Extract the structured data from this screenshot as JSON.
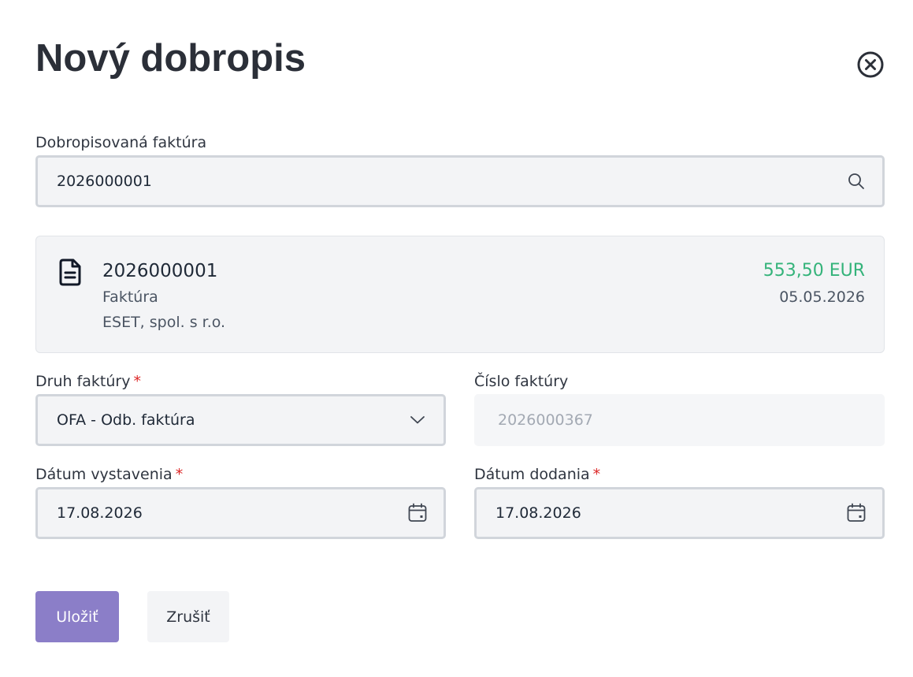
{
  "dialog": {
    "title": "Nový dobropis",
    "close_icon": "close-circle-icon"
  },
  "credited_invoice": {
    "label": "Dobropisovaná faktúra",
    "value": "2026000001",
    "icon": "search-icon"
  },
  "invoice_card": {
    "icon": "document-icon",
    "number": "2026000001",
    "type": "Faktúra",
    "company": "ESET, spol. s r.o.",
    "amount": "553,50 EUR",
    "date": "05.05.2026",
    "amount_color": "#34b37a"
  },
  "invoice_kind": {
    "label": "Druh faktúry",
    "required_mark": "*",
    "value": "OFA - Odb. faktúra",
    "icon": "chevron-down-icon"
  },
  "invoice_number": {
    "label": "Číslo faktúry",
    "value": "2026000367"
  },
  "issue_date": {
    "label": "Dátum vystavenia",
    "required_mark": "*",
    "value": "17.08.2026",
    "icon": "calendar-icon"
  },
  "delivery_date": {
    "label": "Dátum dodania",
    "required_mark": "*",
    "value": "17.08.2026",
    "icon": "calendar-icon"
  },
  "actions": {
    "save_label": "Uložiť",
    "cancel_label": "Zrušiť",
    "save_color": "#8b7ec8"
  }
}
